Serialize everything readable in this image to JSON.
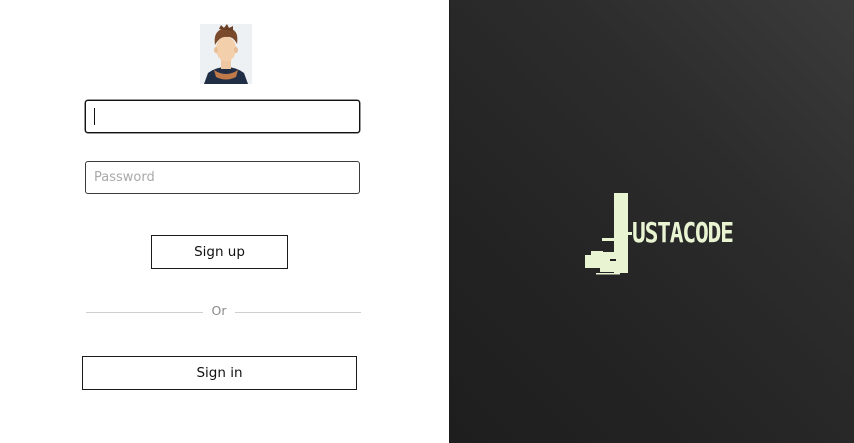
{
  "login_form": {
    "username": {
      "value": "",
      "placeholder": ""
    },
    "password": {
      "value": "",
      "placeholder": "Password"
    },
    "signup_label": "Sign up",
    "divider_label": "Or",
    "signin_label": "Sign in"
  },
  "brand": {
    "logo_text": "USTACODE",
    "logo_color": "#e9f5d2",
    "panel_color": "#2a2a2a"
  },
  "icons": {
    "avatar": "user-avatar-icon"
  }
}
